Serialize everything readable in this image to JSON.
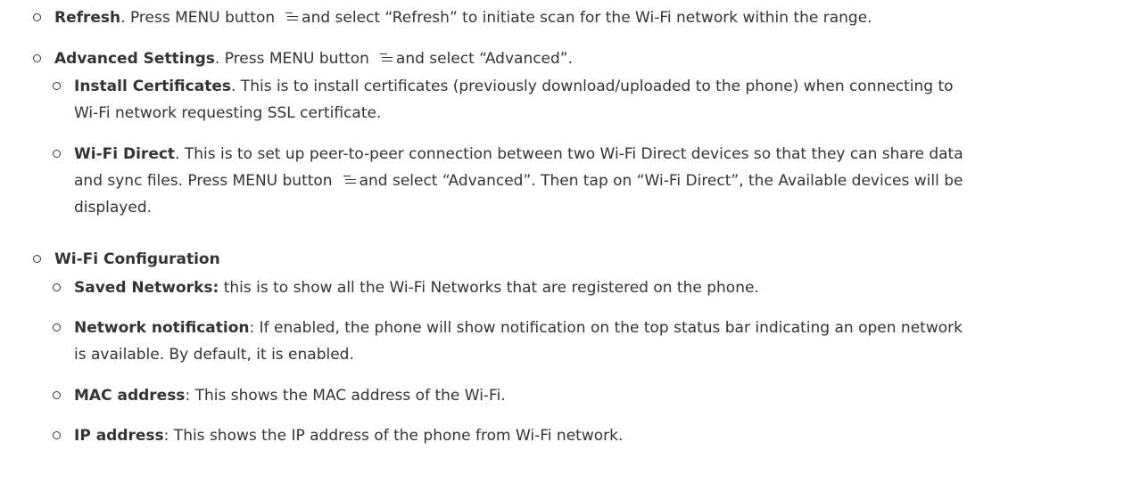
{
  "refresh": {
    "title": "Refresh",
    "before_icon": ". Press MENU button",
    "after_icon": "and select “Refresh” to initiate scan for the Wi-Fi network within the range."
  },
  "advanced": {
    "title": "Advanced Settings",
    "before_icon": ". Press MENU button",
    "after_icon": "and select “Advanced”.",
    "install_certificates": {
      "title": "Install Certificates",
      "line1": ". This is to install certificates (previously download/uploaded to the phone) when connecting to",
      "line2": "Wi-Fi network requesting SSL certificate."
    },
    "wifi_direct": {
      "title": "Wi-Fi Direct",
      "line1": ". This is to set up peer-to-peer connection between two Wi-Fi Direct devices so that they can share data",
      "line2_before_icon": "and sync files. Press MENU button",
      "line2_after_icon": "and select “Advanced”. Then tap on “Wi-Fi Direct”, the Available devices will be",
      "line3": "displayed."
    }
  },
  "configuration": {
    "title": "Wi-Fi Configuration",
    "saved_networks": {
      "title": "Saved Networks:",
      "text": " this is to show all the Wi-Fi Networks that are registered on the phone."
    },
    "network_notification": {
      "title": "Network notification",
      "line1": ": If enabled, the phone will show notification on the top status bar indicating an open network",
      "line2": "is available. By default, it is enabled."
    },
    "mac_address": {
      "title": "MAC address",
      "text": ": This shows the MAC address of the Wi-Fi."
    },
    "ip_address": {
      "title": "IP address",
      "text": ": This shows the IP address of the phone from Wi-Fi network."
    }
  },
  "icons": {
    "menu": "menu-icon"
  }
}
